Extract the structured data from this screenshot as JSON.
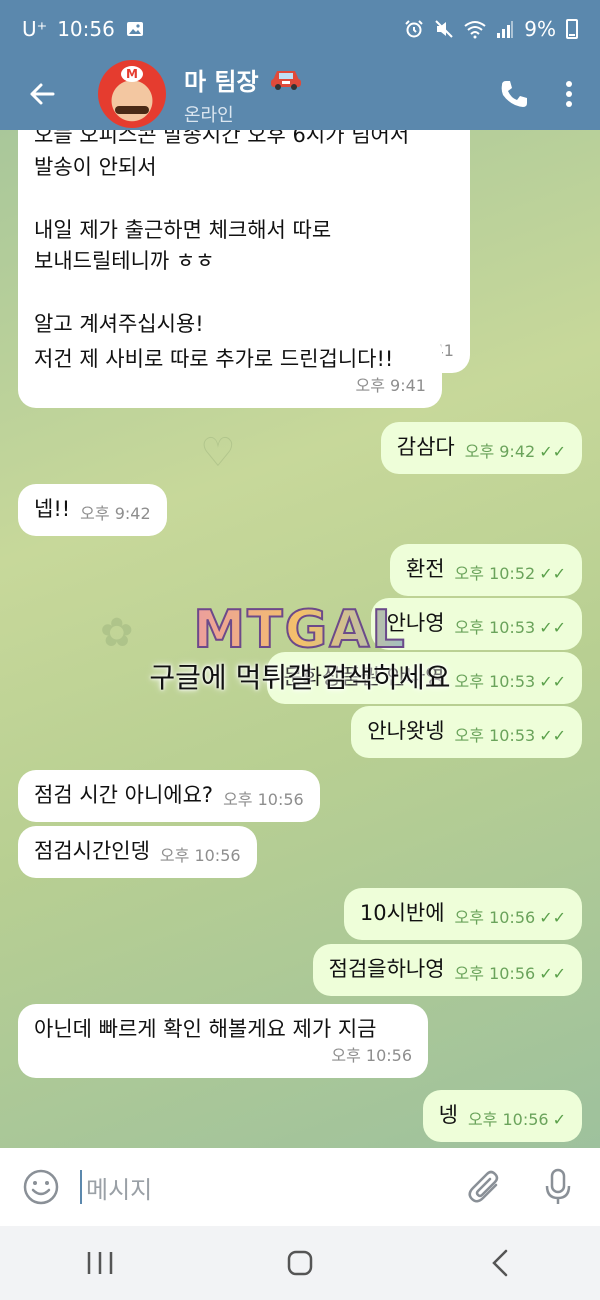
{
  "status_bar": {
    "carrier": "U⁺",
    "time": "10:56",
    "battery": "9%"
  },
  "header": {
    "name": "마 팀장",
    "status": "온라인"
  },
  "messages": [
    {
      "dir": "in",
      "text": "오늘 오피스콘 발송시간 오후 6시가 넘어서\n발송이 안되서\n\n내일 제가 출근하면 체크해서 따로\n보내드릴테니까 ㅎㅎ\n\n알고 계셔주십시용!",
      "time": "오후 9:41"
    },
    {
      "dir": "in",
      "text": "저건 제 사비로 따로 추가로 드린겁니다!!",
      "time": "오후 9:41"
    },
    {
      "dir": "out",
      "text": "감삼다",
      "time": "오후 9:42"
    },
    {
      "dir": "in",
      "text": "넵!!",
      "time": "오후 9:42"
    },
    {
      "dir": "out",
      "text": "환전",
      "time": "오후 10:52"
    },
    {
      "dir": "out",
      "text": "안나영",
      "time": "오후 10:53"
    },
    {
      "dir": "out",
      "text": "문화상품권 안나영",
      "time": "오후 10:53"
    },
    {
      "dir": "out",
      "text": "안나왓넹",
      "time": "오후 10:53"
    },
    {
      "dir": "in",
      "text": "점검 시간 아니에요?",
      "time": "오후 10:56"
    },
    {
      "dir": "in",
      "text": "점검시간인뎅",
      "time": "오후 10:56"
    },
    {
      "dir": "out",
      "text": "10시반에",
      "time": "오후 10:56"
    },
    {
      "dir": "out",
      "text": "점검을하나영",
      "time": "오후 10:56"
    },
    {
      "dir": "in",
      "text": "아닌데 빠르게 확인 해볼게요 제가 지금",
      "time": "오후 10:56"
    },
    {
      "dir": "out",
      "text": "넹",
      "time": "오후 10:56"
    }
  ],
  "watermark": {
    "logo": "MTGAL",
    "text": "구글에 먹튀갤 검색하세요"
  },
  "input": {
    "placeholder": "메시지"
  },
  "icons": {
    "back": "arrow-left-icon",
    "call": "phone-icon",
    "menu": "more-vert-icon",
    "emoji": "emoji-icon",
    "attach": "paperclip-icon",
    "mic": "microphone-icon"
  },
  "colors": {
    "header": "#5b88ad",
    "bubble_in": "#ffffff",
    "bubble_out": "#eefed9",
    "check": "#5aa04a"
  }
}
